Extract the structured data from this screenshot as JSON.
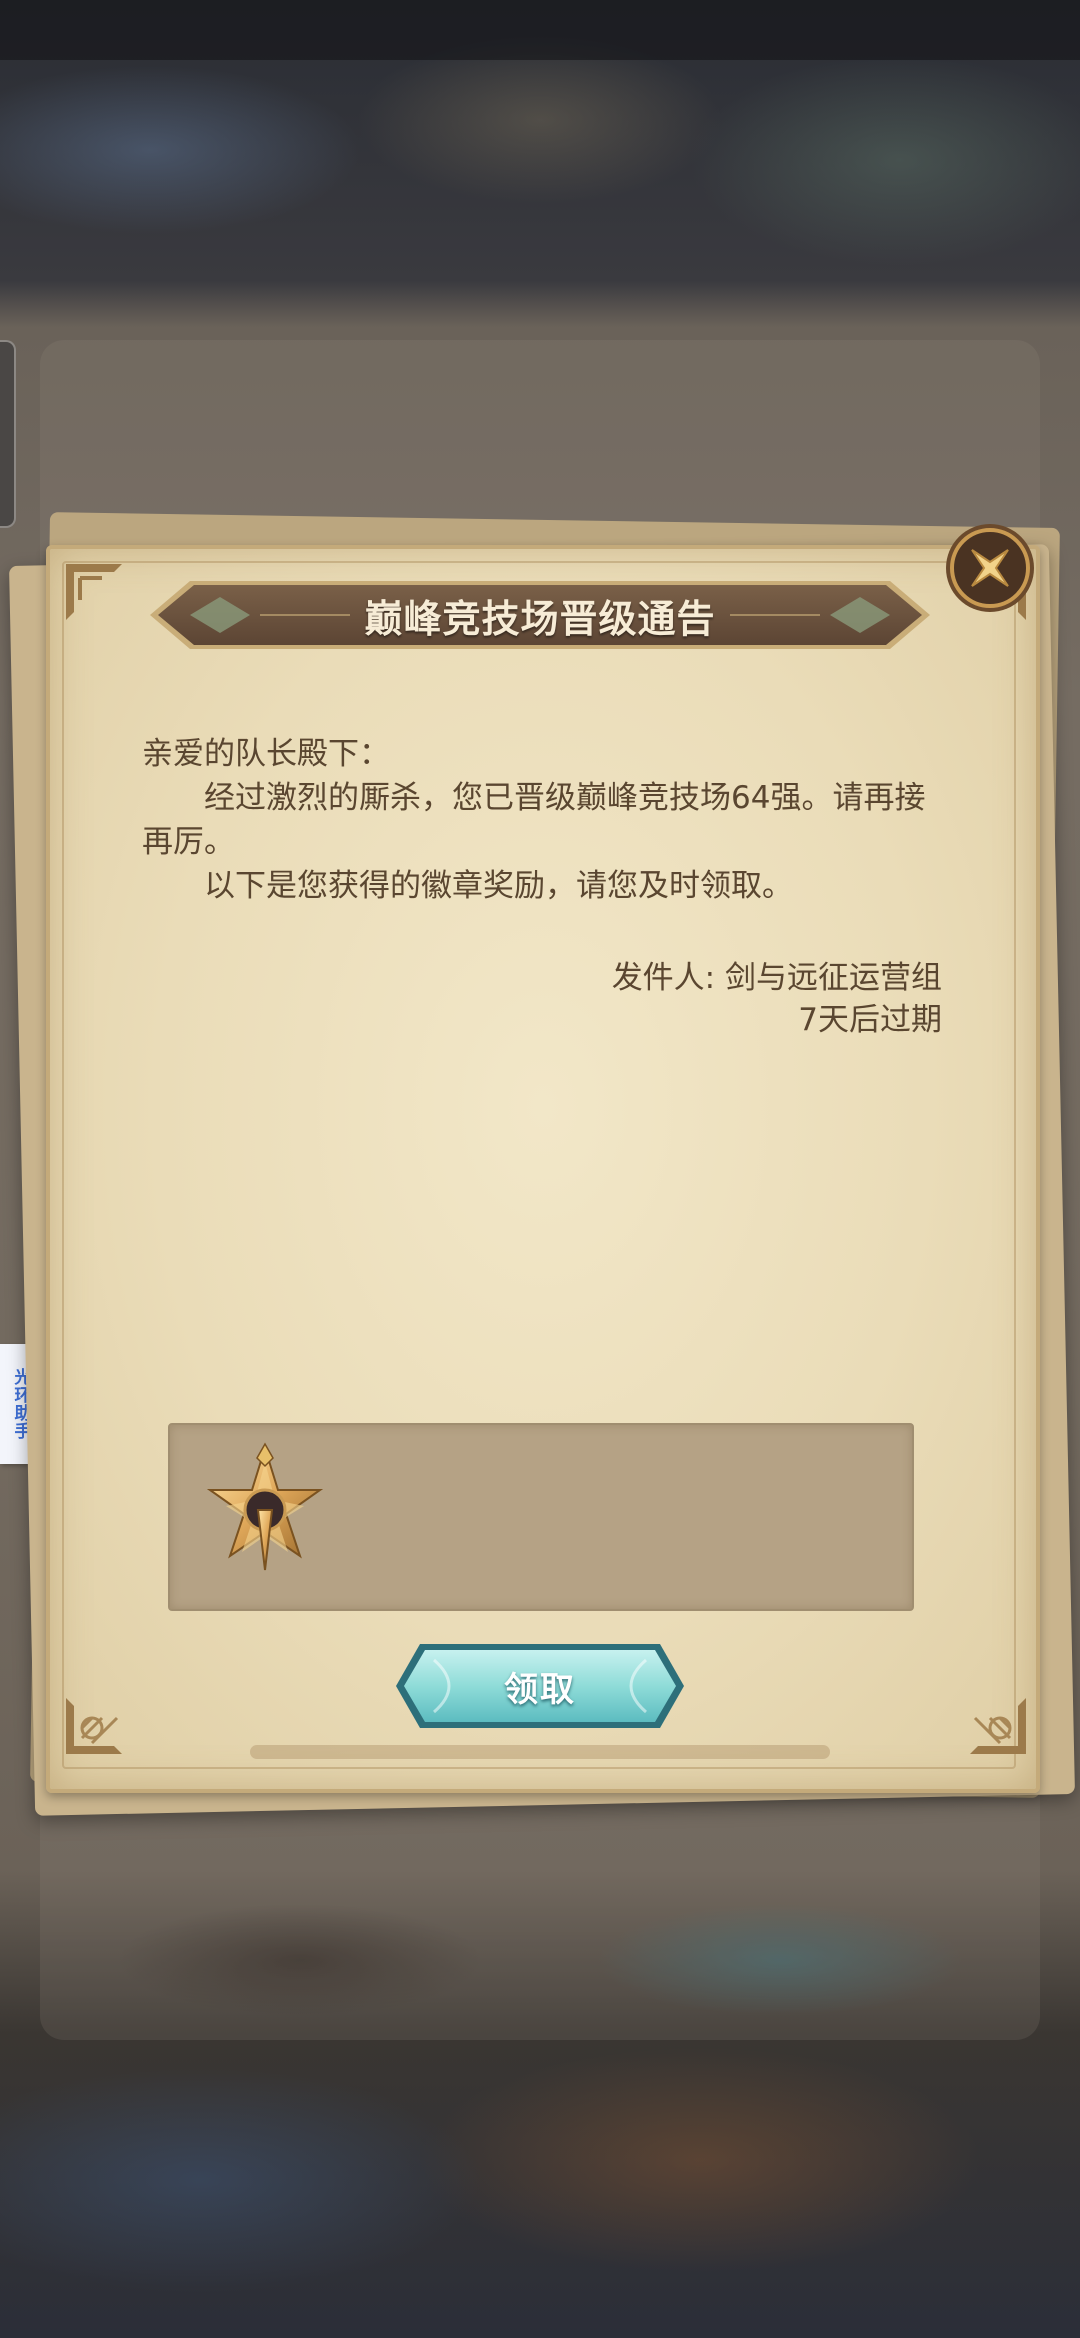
{
  "dialog": {
    "title": "巅峰竞技场晋级通告",
    "greeting": "亲爱的队长殿下：",
    "body_line1": "经过激烈的厮杀，您已晋级巅峰竞技场64强。请再接再厉。",
    "body_line2": "以下是您获得的徽章奖励，请您及时领取。",
    "sender": "发件人: 剑与远征运营组",
    "expiry": "7天后过期",
    "claim_label": "领取",
    "reward_icon": "badge-icon"
  },
  "side_tab": {
    "label": "光环助手"
  },
  "colors": {
    "parchment": "#eadcb8",
    "banner": "#6b5440",
    "text": "#5a4630",
    "button": "#7fd3d6",
    "close_gold": "#e8c06a"
  }
}
